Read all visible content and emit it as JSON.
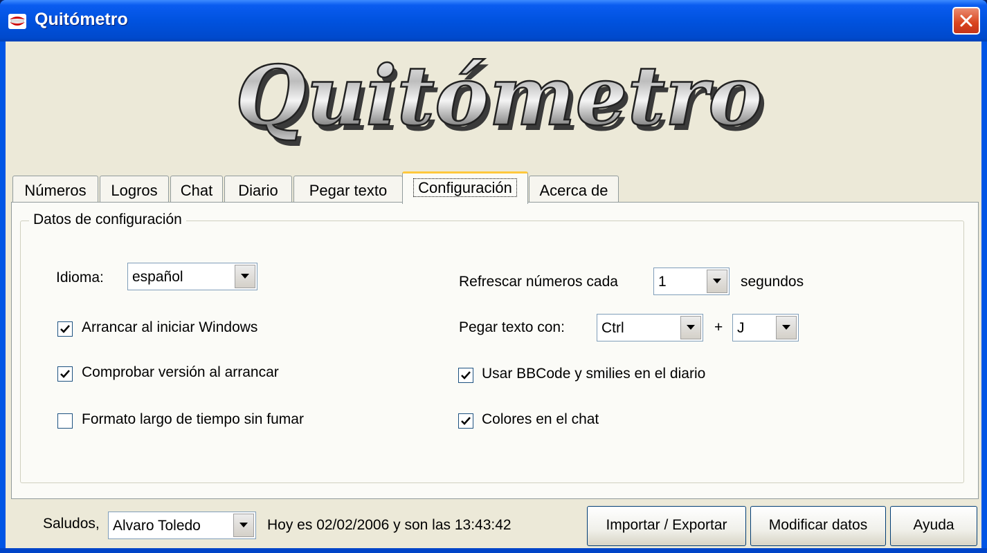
{
  "window": {
    "title": "Quitómetro"
  },
  "logo": {
    "text": "Quitómetro"
  },
  "tabs": [
    {
      "label": "Números"
    },
    {
      "label": "Logros"
    },
    {
      "label": "Chat"
    },
    {
      "label": "Diario"
    },
    {
      "label": "Pegar texto"
    },
    {
      "label": "Configuración",
      "active": true
    },
    {
      "label": "Acerca de"
    }
  ],
  "config": {
    "group_title": "Datos de configuración",
    "idioma_label": "Idioma:",
    "idioma_value": "español",
    "arrancar_label": "Arrancar al iniciar Windows",
    "arrancar_checked": true,
    "comprobar_label": "Comprobar versión al arrancar",
    "comprobar_checked": true,
    "formato_label": "Formato largo de tiempo sin fumar",
    "formato_checked": false,
    "refrescar_label": "Refrescar números cada",
    "refrescar_value": "1",
    "segundos_label": "segundos",
    "pegar_label": "Pegar texto con:",
    "pegar_mod_value": "Ctrl",
    "plus_label": "+",
    "pegar_key_value": "J",
    "bbcode_label": "Usar BBCode y smilies en el diario",
    "bbcode_checked": true,
    "colores_label": "Colores en el chat",
    "colores_checked": true
  },
  "footer": {
    "saludos_label": "Saludos,",
    "user_value": "Alvaro Toledo",
    "status_text": "Hoy es 02/02/2006 y son las 13:43:42",
    "importar_label": "Importar / Exportar",
    "modificar_label": "Modificar datos",
    "ayuda_label": "Ayuda"
  },
  "colors": {
    "titlebar": "#0052de",
    "face": "#ece9d8",
    "panel": "#fbfbf7",
    "tab_highlight": "#ffc83c"
  }
}
